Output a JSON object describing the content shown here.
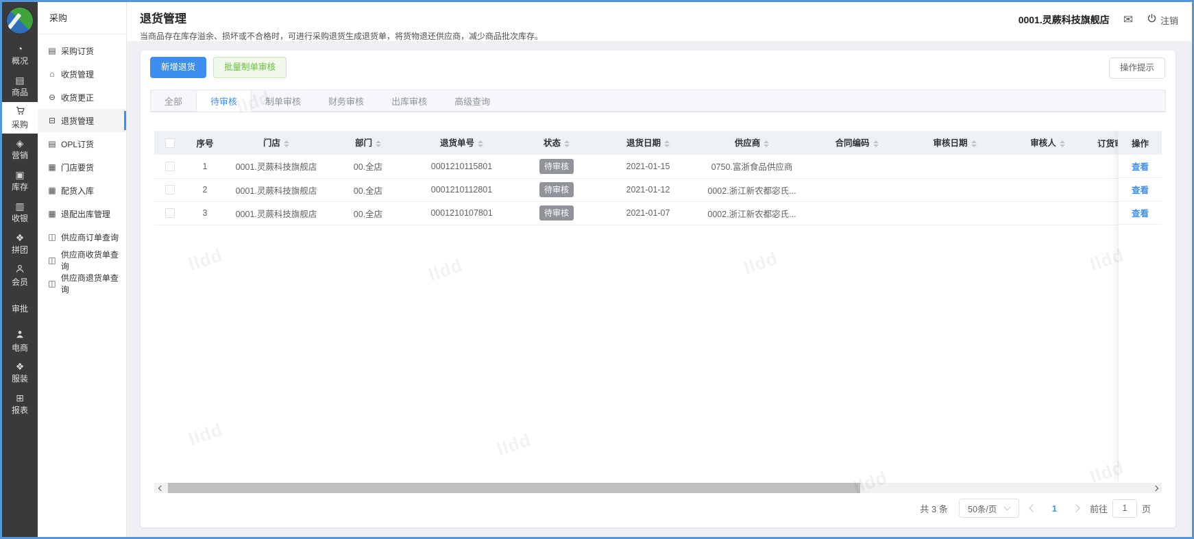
{
  "rail": {
    "items": [
      {
        "label": "概况",
        "icon": "dashboard"
      },
      {
        "label": "商品",
        "icon": "goods"
      },
      {
        "label": "采购",
        "icon": "cart",
        "active": true
      },
      {
        "label": "营销",
        "icon": "marketing"
      },
      {
        "label": "库存",
        "icon": "inventory"
      },
      {
        "label": "收银",
        "icon": "cashier"
      },
      {
        "label": "拼团",
        "icon": "group-buy"
      },
      {
        "label": "会员",
        "icon": "member"
      },
      {
        "label": "审批",
        "icon": "none"
      },
      {
        "label": "电商",
        "icon": "ecommerce"
      },
      {
        "label": "服装",
        "icon": "apparel"
      },
      {
        "label": "报表",
        "icon": "report"
      }
    ]
  },
  "sidebar": {
    "title": "采购",
    "items": [
      {
        "label": "采购订货",
        "icon": "order"
      },
      {
        "label": "收货管理",
        "icon": "receive"
      },
      {
        "label": "收货更正",
        "icon": "correct"
      },
      {
        "label": "退货管理",
        "icon": "return",
        "active": true
      },
      {
        "label": "OPL订货",
        "icon": "opl-order"
      },
      {
        "label": "门店要货",
        "icon": "store-request"
      },
      {
        "label": "配货入库",
        "icon": "allocate-in"
      },
      {
        "label": "退配出库管理",
        "icon": "allocate-out"
      },
      {
        "label": "供应商订单查询",
        "icon": "supplier-order"
      },
      {
        "label": "供应商收货单查询",
        "icon": "supplier-receive"
      },
      {
        "label": "供应商退货单查询",
        "icon": "supplier-return"
      }
    ]
  },
  "topbar": {
    "store": "0001.灵蕨科技旗舰店",
    "logout": "注销"
  },
  "page": {
    "title": "退货管理",
    "description": "当商品存在库存溢余、损坏或不合格时，可进行采购退货生成退货单，将货物退还供应商，减少商品批次库存。"
  },
  "toolbar": {
    "add_label": "新增退货",
    "batch_label": "批量制单审核",
    "tip_label": "操作提示"
  },
  "tabs": [
    {
      "label": "全部"
    },
    {
      "label": "待审核",
      "active": true
    },
    {
      "label": "制单审核"
    },
    {
      "label": "财务审核"
    },
    {
      "label": "出库审核"
    },
    {
      "label": "高级查询"
    }
  ],
  "table": {
    "columns": [
      "序号",
      "门店",
      "部门",
      "退货单号",
      "状态",
      "退货日期",
      "供应商",
      "合同编码",
      "审核日期",
      "审核人",
      "订货审核",
      "操作"
    ],
    "rows": [
      {
        "seq": "1",
        "store": "0001.灵蕨科技旗舰店",
        "dept": "00.全店",
        "order_no": "0001210115801",
        "status": "待审核",
        "return_date": "2021-01-15",
        "supplier": "0750.富浙食品供应商",
        "contract": "",
        "audit_date": "",
        "auditor": "",
        "order_audit": "",
        "action": "查看"
      },
      {
        "seq": "2",
        "store": "0001.灵蕨科技旗舰店",
        "dept": "00.全店",
        "order_no": "0001210112801",
        "status": "待审核",
        "return_date": "2021-01-12",
        "supplier": "0002.浙江新农都宓氏...",
        "contract": "",
        "audit_date": "",
        "auditor": "",
        "order_audit": "",
        "action": "查看"
      },
      {
        "seq": "3",
        "store": "0001.灵蕨科技旗舰店",
        "dept": "00.全店",
        "order_no": "0001210107801",
        "status": "待审核",
        "return_date": "2021-01-07",
        "supplier": "0002.浙江新农都宓氏...",
        "contract": "",
        "audit_date": "",
        "auditor": "",
        "order_audit": "",
        "action": "查看"
      }
    ]
  },
  "pagination": {
    "total_text": "共 3 条",
    "page_size": "50条/页",
    "current": "1",
    "goto_label": "前往",
    "goto_value": "1",
    "unit_label": "页"
  },
  "watermark": {
    "text": "lldd"
  },
  "colors": {
    "accent": "#3d8fef",
    "success_green": "#67c23a",
    "badge_gray": "#909399",
    "rail_bg": "#3a3a3a",
    "frame_border": "#5596d8",
    "table_header_bg": "#eef1f6"
  }
}
